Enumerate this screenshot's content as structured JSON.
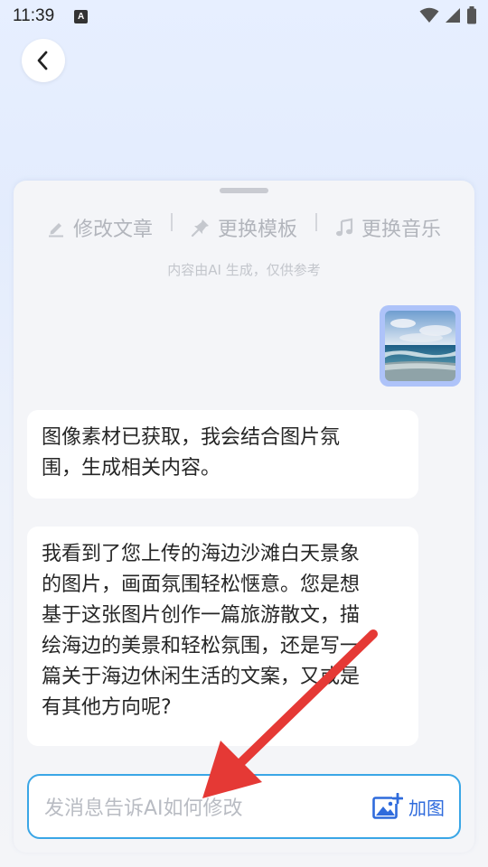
{
  "status_bar": {
    "time": "11:39",
    "notification_letter": "A"
  },
  "nav": {
    "back_icon": "chevron-left-icon"
  },
  "toolbar": {
    "items": [
      {
        "label": "修改文章",
        "icon": "pencil-icon"
      },
      {
        "label": "更换模板",
        "icon": "pin-icon"
      },
      {
        "label": "更换音乐",
        "icon": "music-note-icon"
      }
    ]
  },
  "chat": {
    "disclaimer": "内容由AI 生成，仅供参考",
    "user_image_alt": "beach-photo",
    "messages": [
      {
        "role": "assistant",
        "lines": [
          "图像素材已获取，我会结合图片氛",
          "围，生成相关内容。"
        ]
      },
      {
        "role": "assistant",
        "lines": [
          "我看到了您上传的海边沙滩白天景象",
          "的图片，画面氛围轻松惬意。您是想",
          "基于这张图片创作一篇旅游散文，描",
          "绘海边的美景和轻松氛围，还是写一",
          "篇关于海边休闲生活的文案，又或是",
          "有其他方向呢?"
        ]
      }
    ]
  },
  "composer": {
    "placeholder": "发消息告诉AI如何修改",
    "add_image_label": "加图"
  },
  "colors": {
    "accent": "#2f6bdc",
    "input_border": "#3aa6e6",
    "arrow": "#e53935"
  }
}
